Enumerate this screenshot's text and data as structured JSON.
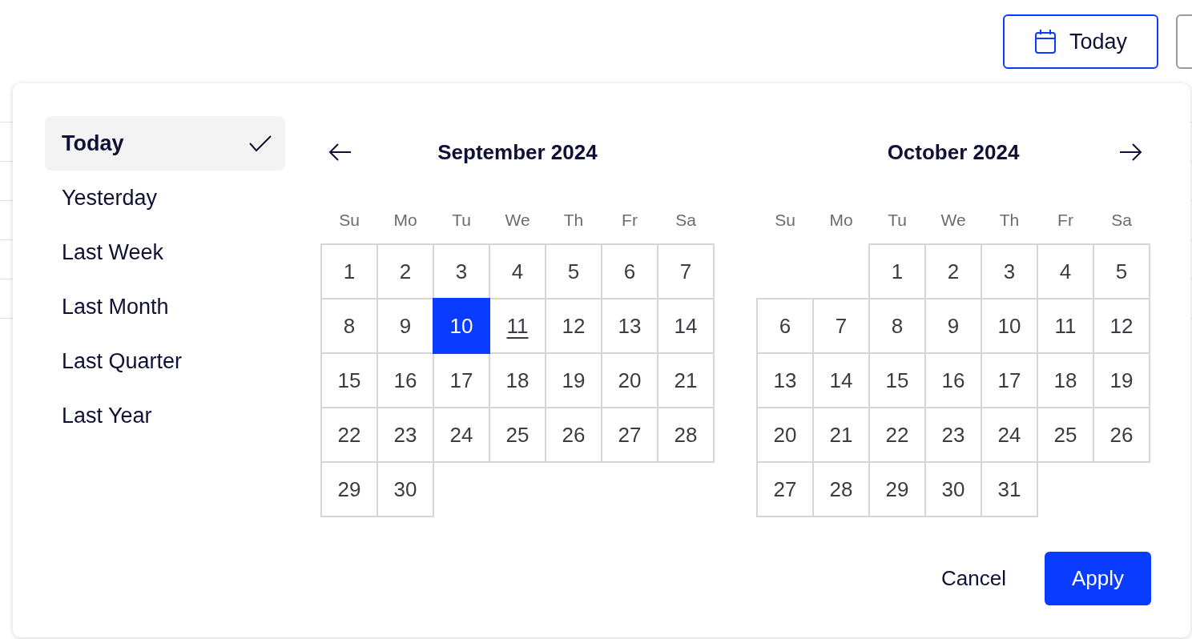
{
  "toolbar": {
    "date_button": {
      "label": "Today"
    }
  },
  "presets": [
    {
      "label": "Today",
      "selected": true
    },
    {
      "label": "Yesterday",
      "selected": false
    },
    {
      "label": "Last Week",
      "selected": false
    },
    {
      "label": "Last Month",
      "selected": false
    },
    {
      "label": "Last Quarter",
      "selected": false
    },
    {
      "label": "Last Year",
      "selected": false
    }
  ],
  "calendars": [
    {
      "title": "September 2024",
      "weekdays": [
        "Su",
        "Mo",
        "Tu",
        "We",
        "Th",
        "Fr",
        "Sa"
      ],
      "weeks": [
        [
          {
            "day": "1",
            "selected": false,
            "today": false
          },
          {
            "day": "2",
            "selected": false,
            "today": false
          },
          {
            "day": "3",
            "selected": false,
            "today": false
          },
          {
            "day": "4",
            "selected": false,
            "today": false
          },
          {
            "day": "5",
            "selected": false,
            "today": false
          },
          {
            "day": "6",
            "selected": false,
            "today": false
          },
          {
            "day": "7",
            "selected": false,
            "today": false
          }
        ],
        [
          {
            "day": "8",
            "selected": false,
            "today": false
          },
          {
            "day": "9",
            "selected": false,
            "today": false
          },
          {
            "day": "10",
            "selected": true,
            "today": false
          },
          {
            "day": "11",
            "selected": false,
            "today": true
          },
          {
            "day": "12",
            "selected": false,
            "today": false
          },
          {
            "day": "13",
            "selected": false,
            "today": false
          },
          {
            "day": "14",
            "selected": false,
            "today": false
          }
        ],
        [
          {
            "day": "15",
            "selected": false,
            "today": false
          },
          {
            "day": "16",
            "selected": false,
            "today": false
          },
          {
            "day": "17",
            "selected": false,
            "today": false
          },
          {
            "day": "18",
            "selected": false,
            "today": false
          },
          {
            "day": "19",
            "selected": false,
            "today": false
          },
          {
            "day": "20",
            "selected": false,
            "today": false
          },
          {
            "day": "21",
            "selected": false,
            "today": false
          }
        ],
        [
          {
            "day": "22",
            "selected": false,
            "today": false
          },
          {
            "day": "23",
            "selected": false,
            "today": false
          },
          {
            "day": "24",
            "selected": false,
            "today": false
          },
          {
            "day": "25",
            "selected": false,
            "today": false
          },
          {
            "day": "26",
            "selected": false,
            "today": false
          },
          {
            "day": "27",
            "selected": false,
            "today": false
          },
          {
            "day": "28",
            "selected": false,
            "today": false
          }
        ],
        [
          {
            "day": "29",
            "selected": false,
            "today": false
          },
          {
            "day": "30",
            "selected": false,
            "today": false
          }
        ]
      ]
    },
    {
      "title": "October 2024",
      "weekdays": [
        "Su",
        "Mo",
        "Tu",
        "We",
        "Th",
        "Fr",
        "Sa"
      ],
      "weeks": [
        [
          {
            "kind": "blank"
          },
          {
            "kind": "blank"
          },
          {
            "kind": "day",
            "day": "1",
            "selected": false,
            "today": false
          },
          {
            "day": "2",
            "selected": false,
            "today": false
          },
          {
            "day": "3",
            "selected": false,
            "today": false
          },
          {
            "day": "4",
            "selected": false,
            "today": false
          },
          {
            "day": "5",
            "selected": false,
            "today": false
          }
        ],
        [
          {
            "day": "6",
            "selected": false,
            "today": false
          },
          {
            "day": "7",
            "selected": false,
            "today": false
          },
          {
            "day": "8",
            "selected": false,
            "today": false
          },
          {
            "day": "9",
            "selected": false,
            "today": false
          },
          {
            "day": "10",
            "selected": false,
            "today": false
          },
          {
            "day": "11",
            "selected": false,
            "today": false
          },
          {
            "day": "12",
            "selected": false,
            "today": false
          }
        ],
        [
          {
            "day": "13",
            "selected": false,
            "today": false
          },
          {
            "day": "14",
            "selected": false,
            "today": false
          },
          {
            "day": "15",
            "selected": false,
            "today": false
          },
          {
            "day": "16",
            "selected": false,
            "today": false
          },
          {
            "day": "17",
            "selected": false,
            "today": false
          },
          {
            "day": "18",
            "selected": false,
            "today": false
          },
          {
            "day": "19",
            "selected": false,
            "today": false
          }
        ],
        [
          {
            "day": "20",
            "selected": false,
            "today": false
          },
          {
            "day": "21",
            "selected": false,
            "today": false
          },
          {
            "day": "22",
            "selected": false,
            "today": false
          },
          {
            "day": "23",
            "selected": false,
            "today": false
          },
          {
            "day": "24",
            "selected": false,
            "today": false
          },
          {
            "day": "25",
            "selected": false,
            "today": false
          },
          {
            "day": "26",
            "selected": false,
            "today": false
          }
        ],
        [
          {
            "day": "27",
            "selected": false,
            "today": false
          },
          {
            "day": "28",
            "selected": false,
            "today": false
          },
          {
            "day": "29",
            "selected": false,
            "today": false
          },
          {
            "day": "30",
            "selected": false,
            "today": false
          },
          {
            "day": "31",
            "selected": false,
            "today": false
          }
        ]
      ]
    }
  ],
  "footer": {
    "cancel": "Cancel",
    "apply": "Apply"
  }
}
